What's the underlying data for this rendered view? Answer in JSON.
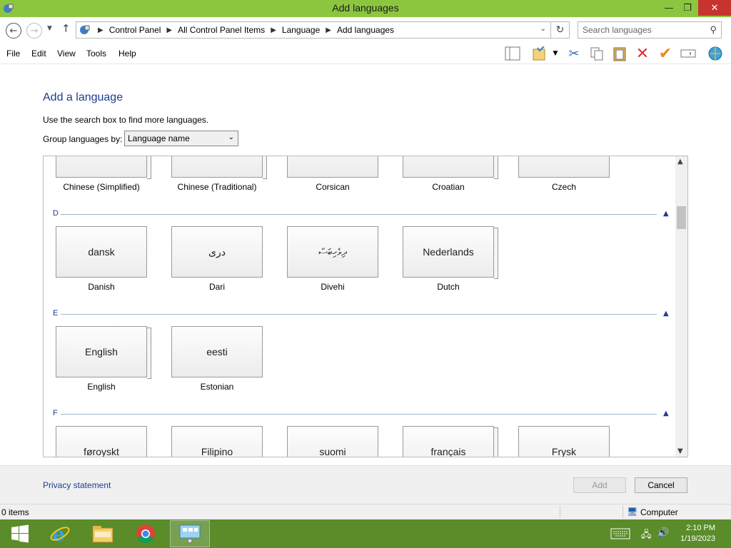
{
  "window": {
    "title": "Add languages"
  },
  "address": {
    "crumbs": [
      "Control Panel",
      "All Control Panel Items",
      "Language",
      "Add languages"
    ],
    "search_placeholder": "Search languages"
  },
  "menu": [
    "File",
    "Edit",
    "View",
    "Tools",
    "Help"
  ],
  "toolbar_icons": [
    "layout-icon",
    "properties-icon",
    "cut-icon",
    "copy-icon",
    "paste-icon",
    "delete-icon",
    "check-icon",
    "rename-icon",
    "globe-icon"
  ],
  "page": {
    "heading": "Add a language",
    "hint": "Use the search box to find more languages.",
    "group_label": "Group languages by:",
    "group_value": "Language name"
  },
  "top_row": [
    {
      "label": "Chinese (Simplified)"
    },
    {
      "label": "Chinese (Traditional)"
    },
    {
      "label": "Corsican"
    },
    {
      "label": "Croatian"
    },
    {
      "label": "Czech"
    }
  ],
  "sections": [
    {
      "letter": "D",
      "tiles": [
        {
          "native": "dansk",
          "label": "Danish"
        },
        {
          "native": "دری",
          "label": "Dari"
        },
        {
          "native": "ދިވެހިބަސް",
          "label": "Divehi"
        },
        {
          "native": "Nederlands",
          "label": "Dutch"
        }
      ]
    },
    {
      "letter": "E",
      "tiles": [
        {
          "native": "English",
          "label": "English"
        },
        {
          "native": "eesti",
          "label": "Estonian"
        }
      ]
    },
    {
      "letter": "F",
      "tiles": [
        {
          "native": "føroyskt",
          "label": ""
        },
        {
          "native": "Filipino",
          "label": ""
        },
        {
          "native": "suomi",
          "label": ""
        },
        {
          "native": "français",
          "label": ""
        },
        {
          "native": "Frysk",
          "label": ""
        }
      ]
    }
  ],
  "footer": {
    "privacy": "Privacy statement",
    "add": "Add",
    "cancel": "Cancel"
  },
  "status": {
    "items": "0 items",
    "location": "Computer"
  },
  "clock": {
    "time": "2:10 PM",
    "date": "1/19/2023"
  },
  "colors": {
    "titlebar": "#8cc63f",
    "taskbar": "#5a8c2a",
    "accent": "#1e3d8f"
  }
}
